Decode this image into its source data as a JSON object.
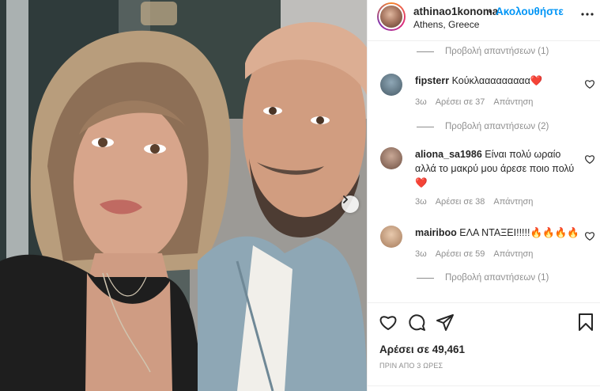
{
  "post": {
    "username": "athinao1konoma",
    "separator": "•",
    "follow_label": "Ακολουθήστε",
    "location": "Athens, Greece",
    "more_icon": "more-horizontal-icon"
  },
  "comments": {
    "view_replies_1": "Προβολή απαντήσεων (1)",
    "view_replies_2": "Προβολή απαντήσεων (2)",
    "view_replies_3": "Προβολή απαντήσεων (1)",
    "items": [
      {
        "username": "fipsterr",
        "text": "Κούκλααααααααα",
        "emoji": "❤️",
        "age": "3ω",
        "likes": "Αρέσει σε 37",
        "reply": "Απάντηση"
      },
      {
        "username": "aliona_sa1986",
        "text": "Είναι πολύ ωραίο αλλά το μακρύ μου άρεσε ποιο πολύ",
        "emoji": "❤️",
        "age": "3ω",
        "likes": "Αρέσει σε 38",
        "reply": "Απάντηση"
      },
      {
        "username": "mairiboo",
        "text": "ΕΛΑ ΝΤΑΞΕΙ!!!!!",
        "emoji": "🔥🔥🔥🔥",
        "age": "3ω",
        "likes": "Αρέσει σε 59",
        "reply": "Απάντηση"
      }
    ]
  },
  "actions": {
    "likes": "Αρέσει σε 49,461",
    "time": "ΠΡΙΝ ΑΠΟ 3 ΩΡΕΣ"
  },
  "colors": {
    "accent": "#0095f6",
    "heart": "#ed4956",
    "muted": "#8e8e8e",
    "text": "#262626"
  }
}
